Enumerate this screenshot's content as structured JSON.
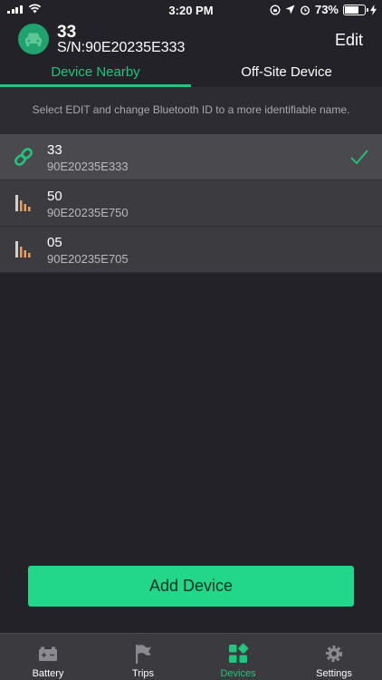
{
  "status_bar": {
    "time": "3:20 PM",
    "battery": "73%"
  },
  "header": {
    "title": "33",
    "serial": "S/N:90E20235E333",
    "edit_label": "Edit"
  },
  "tabs": {
    "nearby": "Device Nearby",
    "offsite": "Off-Site Device"
  },
  "hint": "Select EDIT and change Bluetooth ID to a more identifiable name.",
  "devices": [
    {
      "name": "33",
      "serial": "90E20235E333",
      "icon": "link-icon",
      "selected": true
    },
    {
      "name": "50",
      "serial": "90E20235E750",
      "icon": "signal-bars-icon",
      "selected": false
    },
    {
      "name": "05",
      "serial": "90E20235E705",
      "icon": "signal-bars-icon",
      "selected": false
    }
  ],
  "add_device_label": "Add Device",
  "tabbar": [
    {
      "label": "Battery",
      "icon": "battery-icon"
    },
    {
      "label": "Trips",
      "icon": "flag-icon"
    },
    {
      "label": "Devices",
      "icon": "devices-grid-icon",
      "active": true
    },
    {
      "label": "Settings",
      "icon": "gear-icon"
    }
  ],
  "colors": {
    "accent": "#22c47e",
    "button": "#22d68a",
    "background": "#222228",
    "row": "#3b3b40"
  }
}
